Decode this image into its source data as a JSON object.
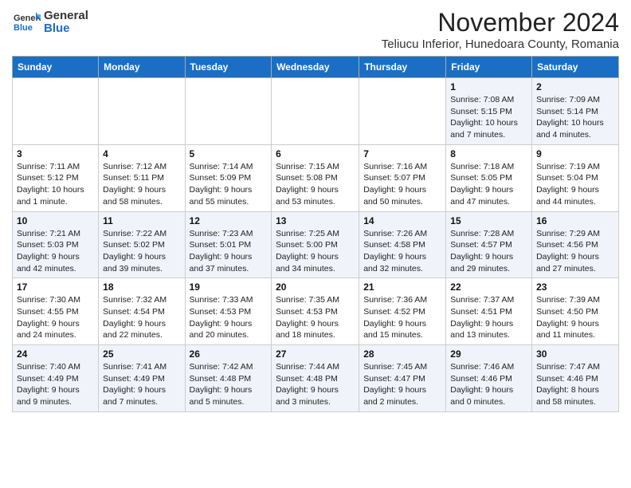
{
  "header": {
    "logo_general": "General",
    "logo_blue": "Blue",
    "month_title": "November 2024",
    "location": "Teliucu Inferior, Hunedoara County, Romania"
  },
  "weekdays": [
    "Sunday",
    "Monday",
    "Tuesday",
    "Wednesday",
    "Thursday",
    "Friday",
    "Saturday"
  ],
  "weeks": [
    [
      {
        "day": "",
        "info": ""
      },
      {
        "day": "",
        "info": ""
      },
      {
        "day": "",
        "info": ""
      },
      {
        "day": "",
        "info": ""
      },
      {
        "day": "",
        "info": ""
      },
      {
        "day": "1",
        "info": "Sunrise: 7:08 AM\nSunset: 5:15 PM\nDaylight: 10 hours and 7 minutes."
      },
      {
        "day": "2",
        "info": "Sunrise: 7:09 AM\nSunset: 5:14 PM\nDaylight: 10 hours and 4 minutes."
      }
    ],
    [
      {
        "day": "3",
        "info": "Sunrise: 7:11 AM\nSunset: 5:12 PM\nDaylight: 10 hours and 1 minute."
      },
      {
        "day": "4",
        "info": "Sunrise: 7:12 AM\nSunset: 5:11 PM\nDaylight: 9 hours and 58 minutes."
      },
      {
        "day": "5",
        "info": "Sunrise: 7:14 AM\nSunset: 5:09 PM\nDaylight: 9 hours and 55 minutes."
      },
      {
        "day": "6",
        "info": "Sunrise: 7:15 AM\nSunset: 5:08 PM\nDaylight: 9 hours and 53 minutes."
      },
      {
        "day": "7",
        "info": "Sunrise: 7:16 AM\nSunset: 5:07 PM\nDaylight: 9 hours and 50 minutes."
      },
      {
        "day": "8",
        "info": "Sunrise: 7:18 AM\nSunset: 5:05 PM\nDaylight: 9 hours and 47 minutes."
      },
      {
        "day": "9",
        "info": "Sunrise: 7:19 AM\nSunset: 5:04 PM\nDaylight: 9 hours and 44 minutes."
      }
    ],
    [
      {
        "day": "10",
        "info": "Sunrise: 7:21 AM\nSunset: 5:03 PM\nDaylight: 9 hours and 42 minutes."
      },
      {
        "day": "11",
        "info": "Sunrise: 7:22 AM\nSunset: 5:02 PM\nDaylight: 9 hours and 39 minutes."
      },
      {
        "day": "12",
        "info": "Sunrise: 7:23 AM\nSunset: 5:01 PM\nDaylight: 9 hours and 37 minutes."
      },
      {
        "day": "13",
        "info": "Sunrise: 7:25 AM\nSunset: 5:00 PM\nDaylight: 9 hours and 34 minutes."
      },
      {
        "day": "14",
        "info": "Sunrise: 7:26 AM\nSunset: 4:58 PM\nDaylight: 9 hours and 32 minutes."
      },
      {
        "day": "15",
        "info": "Sunrise: 7:28 AM\nSunset: 4:57 PM\nDaylight: 9 hours and 29 minutes."
      },
      {
        "day": "16",
        "info": "Sunrise: 7:29 AM\nSunset: 4:56 PM\nDaylight: 9 hours and 27 minutes."
      }
    ],
    [
      {
        "day": "17",
        "info": "Sunrise: 7:30 AM\nSunset: 4:55 PM\nDaylight: 9 hours and 24 minutes."
      },
      {
        "day": "18",
        "info": "Sunrise: 7:32 AM\nSunset: 4:54 PM\nDaylight: 9 hours and 22 minutes."
      },
      {
        "day": "19",
        "info": "Sunrise: 7:33 AM\nSunset: 4:53 PM\nDaylight: 9 hours and 20 minutes."
      },
      {
        "day": "20",
        "info": "Sunrise: 7:35 AM\nSunset: 4:53 PM\nDaylight: 9 hours and 18 minutes."
      },
      {
        "day": "21",
        "info": "Sunrise: 7:36 AM\nSunset: 4:52 PM\nDaylight: 9 hours and 15 minutes."
      },
      {
        "day": "22",
        "info": "Sunrise: 7:37 AM\nSunset: 4:51 PM\nDaylight: 9 hours and 13 minutes."
      },
      {
        "day": "23",
        "info": "Sunrise: 7:39 AM\nSunset: 4:50 PM\nDaylight: 9 hours and 11 minutes."
      }
    ],
    [
      {
        "day": "24",
        "info": "Sunrise: 7:40 AM\nSunset: 4:49 PM\nDaylight: 9 hours and 9 minutes."
      },
      {
        "day": "25",
        "info": "Sunrise: 7:41 AM\nSunset: 4:49 PM\nDaylight: 9 hours and 7 minutes."
      },
      {
        "day": "26",
        "info": "Sunrise: 7:42 AM\nSunset: 4:48 PM\nDaylight: 9 hours and 5 minutes."
      },
      {
        "day": "27",
        "info": "Sunrise: 7:44 AM\nSunset: 4:48 PM\nDaylight: 9 hours and 3 minutes."
      },
      {
        "day": "28",
        "info": "Sunrise: 7:45 AM\nSunset: 4:47 PM\nDaylight: 9 hours and 2 minutes."
      },
      {
        "day": "29",
        "info": "Sunrise: 7:46 AM\nSunset: 4:46 PM\nDaylight: 9 hours and 0 minutes."
      },
      {
        "day": "30",
        "info": "Sunrise: 7:47 AM\nSunset: 4:46 PM\nDaylight: 8 hours and 58 minutes."
      }
    ]
  ]
}
